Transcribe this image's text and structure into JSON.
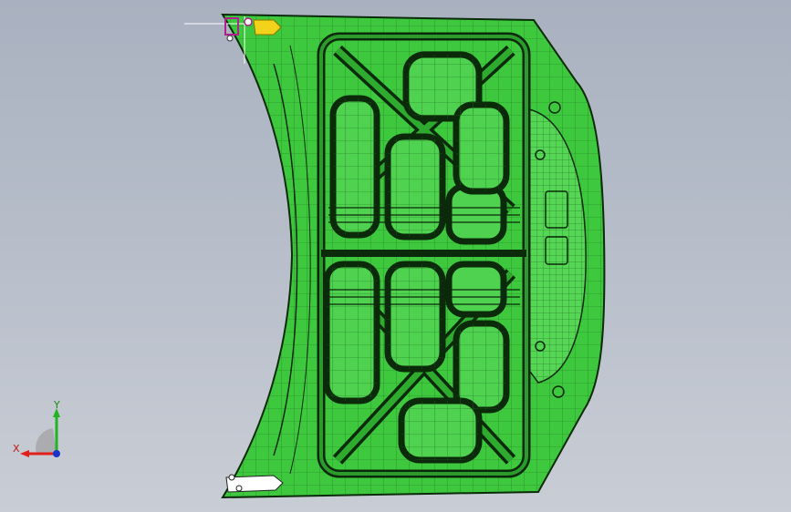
{
  "viewport": {
    "model": "hood-inner-panel-3d-model"
  },
  "triad": {
    "x_label": "X",
    "y_label": "Y",
    "x_color": "#e0201a",
    "y_color": "#22b322",
    "z_color": "#1a33c8"
  },
  "colors": {
    "model_fill": "#3ec83e",
    "model_fill_light": "#55d655",
    "edge": "#0a2a0a",
    "highlight_yellow": "#f2d21a",
    "highlight_magenta": "#b0208c",
    "background_top": "#a9b1c0",
    "background_bottom": "#c9cdd5"
  }
}
